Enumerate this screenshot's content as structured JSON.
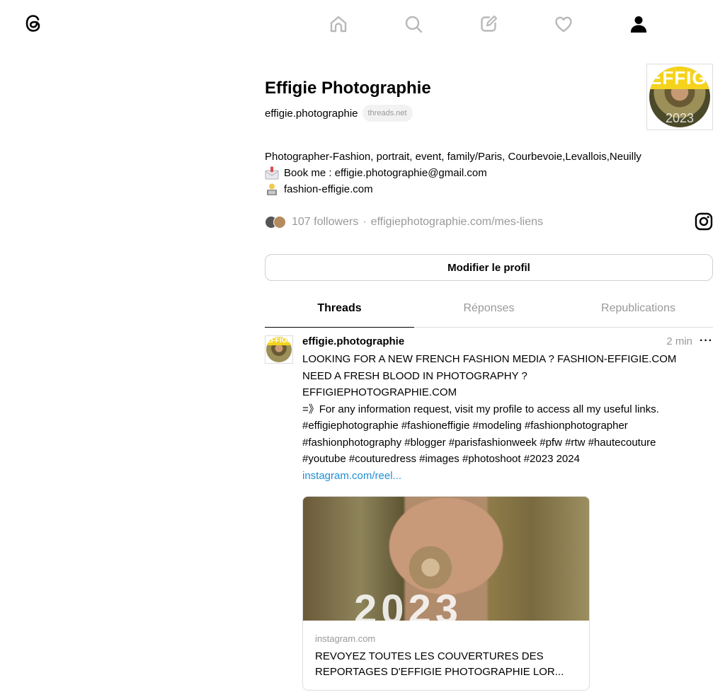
{
  "nav": {
    "items": [
      {
        "name": "home-icon"
      },
      {
        "name": "search-icon"
      },
      {
        "name": "compose-icon"
      },
      {
        "name": "heart-icon"
      },
      {
        "name": "profile-icon"
      }
    ]
  },
  "profile": {
    "display_name": "Effigie Photographie",
    "handle": "effigie.photographie",
    "domain_chip": "threads.net",
    "avatar_banner": "EFFIGIE",
    "avatar_year": "2023",
    "bio": [
      "Photographer-Fashion, portrait, event, family/Paris, Courbevoie,Levallois,Neuilly",
      "Book me : effigie.photographie@gmail.com",
      "fashion-effigie.com"
    ],
    "followers": "107 followers",
    "separator": "·",
    "website": "effigiephotographie.com/mes-liens",
    "edit_button": "Modifier le profil"
  },
  "tabs": [
    {
      "label": "Threads",
      "active": true
    },
    {
      "label": "Réponses",
      "active": false
    },
    {
      "label": "Republications",
      "active": false
    }
  ],
  "post": {
    "author": "effigie.photographie",
    "time": "2 min",
    "more": "···",
    "text": "LOOKING FOR A NEW FRENCH FASHION MEDIA ? FASHION-EFFIGIE.COM\nNEED A FRESH BLOOD IN PHOTOGRAPHY ?\nEFFIGIEPHOTOGRAPHIE.COM\n=》For any information request, visit my profile to access all my useful links.\n#effigiephotographie #fashioneffigie #modeling #fashionphotographer\n#fashionphotography #blogger #parisfashionweek #pfw #rtw #hautecouture\n#youtube #couturedress #images #photoshoot #2023 2024",
    "link": "instagram.com/reel...",
    "card": {
      "image_text": "2023",
      "domain": "instagram.com",
      "title": "REVOYEZ TOUTES LES COUVERTURES DES REPORTAGES D'EFFIGIE PHOTOGRAPHIE LOR..."
    }
  },
  "colors": {
    "link": "#1f8fd6",
    "muted": "#999999",
    "border": "#dddddd",
    "banner": "#f5d31c"
  }
}
